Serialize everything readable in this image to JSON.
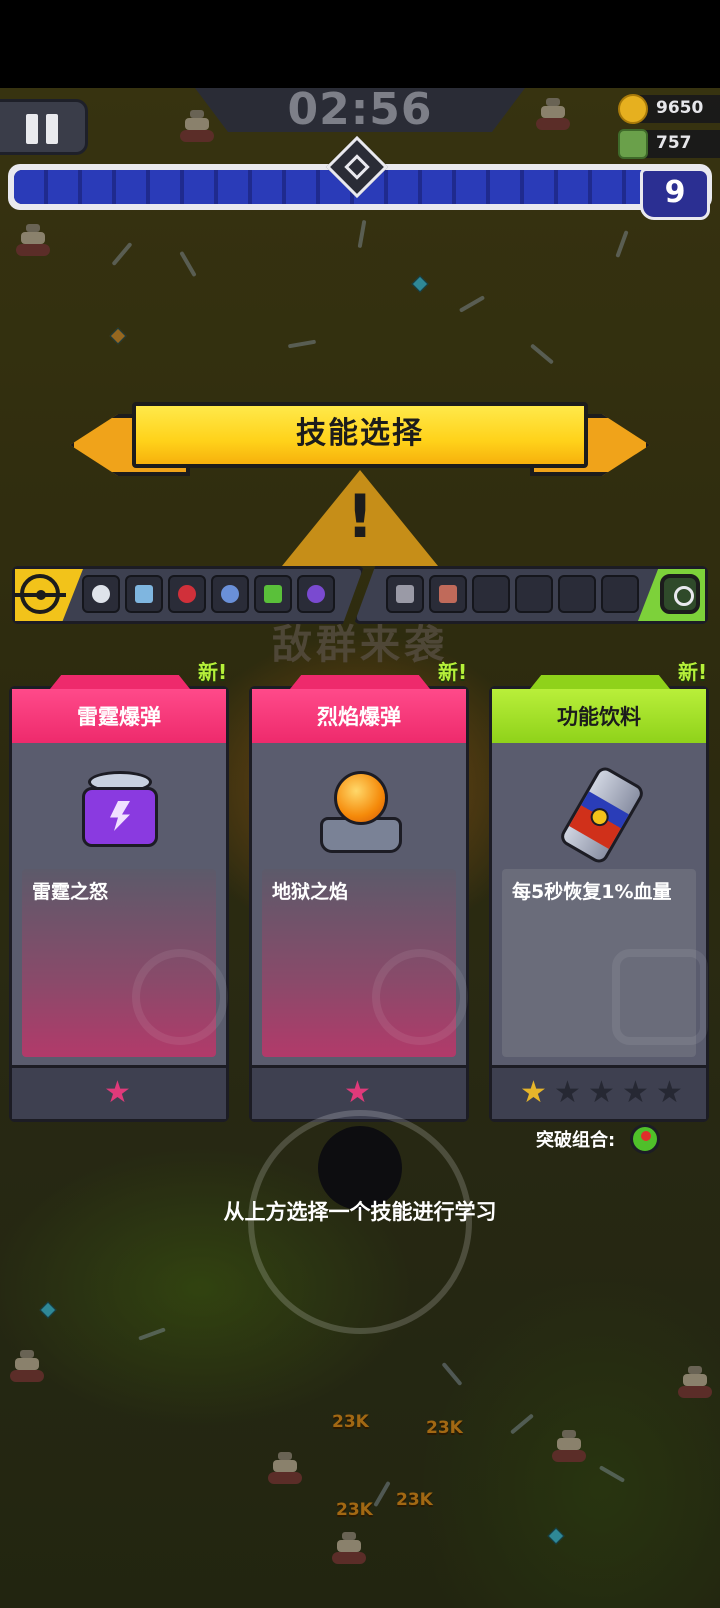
{
  "hud": {
    "timer": "02:56",
    "coins": "9650",
    "kills": "757",
    "level": "9",
    "xp_progress": 0.92
  },
  "title": "技能选择",
  "warning_text": "敌群来袭",
  "slots": {
    "left_icons": [
      "swirl-skill-icon",
      "drink-skill-icon",
      "target-skill-icon",
      "drone-skill-icon",
      "bottle-skill-icon",
      "tower-skill-icon"
    ],
    "right_icons": [
      "boot-passive-icon",
      "armor-passive-icon"
    ],
    "right_empty": 4
  },
  "cards": [
    {
      "name": "雷霆爆弹",
      "desc": "雷霆之怒",
      "new_label": "新!",
      "rarity": "pink",
      "icon": "thunder-bomb-icon",
      "stars_filled": 0,
      "stars_total": 1
    },
    {
      "name": "烈焰爆弹",
      "desc": "地狱之焰",
      "new_label": "新!",
      "rarity": "pink",
      "icon": "fire-bomb-icon",
      "stars_filled": 0,
      "stars_total": 1
    },
    {
      "name": "功能饮料",
      "desc": "每5秒恢复1%血量",
      "new_label": "新!",
      "rarity": "green",
      "icon": "energy-drink-icon",
      "stars_filled": 1,
      "stars_total": 5
    }
  ],
  "breakthrough_label": "突破组合:",
  "instruction": "从上方选择一个技能进行学习",
  "damage_numbers": [
    "23K",
    "23K",
    "23K",
    "23K"
  ],
  "colors": {
    "xp_fill": "#2a3bb8",
    "title_banner": "#ffd21a",
    "card_pink": "#ee2a6c",
    "card_green": "#8fd21a",
    "new_tag": "#b6f03a"
  }
}
